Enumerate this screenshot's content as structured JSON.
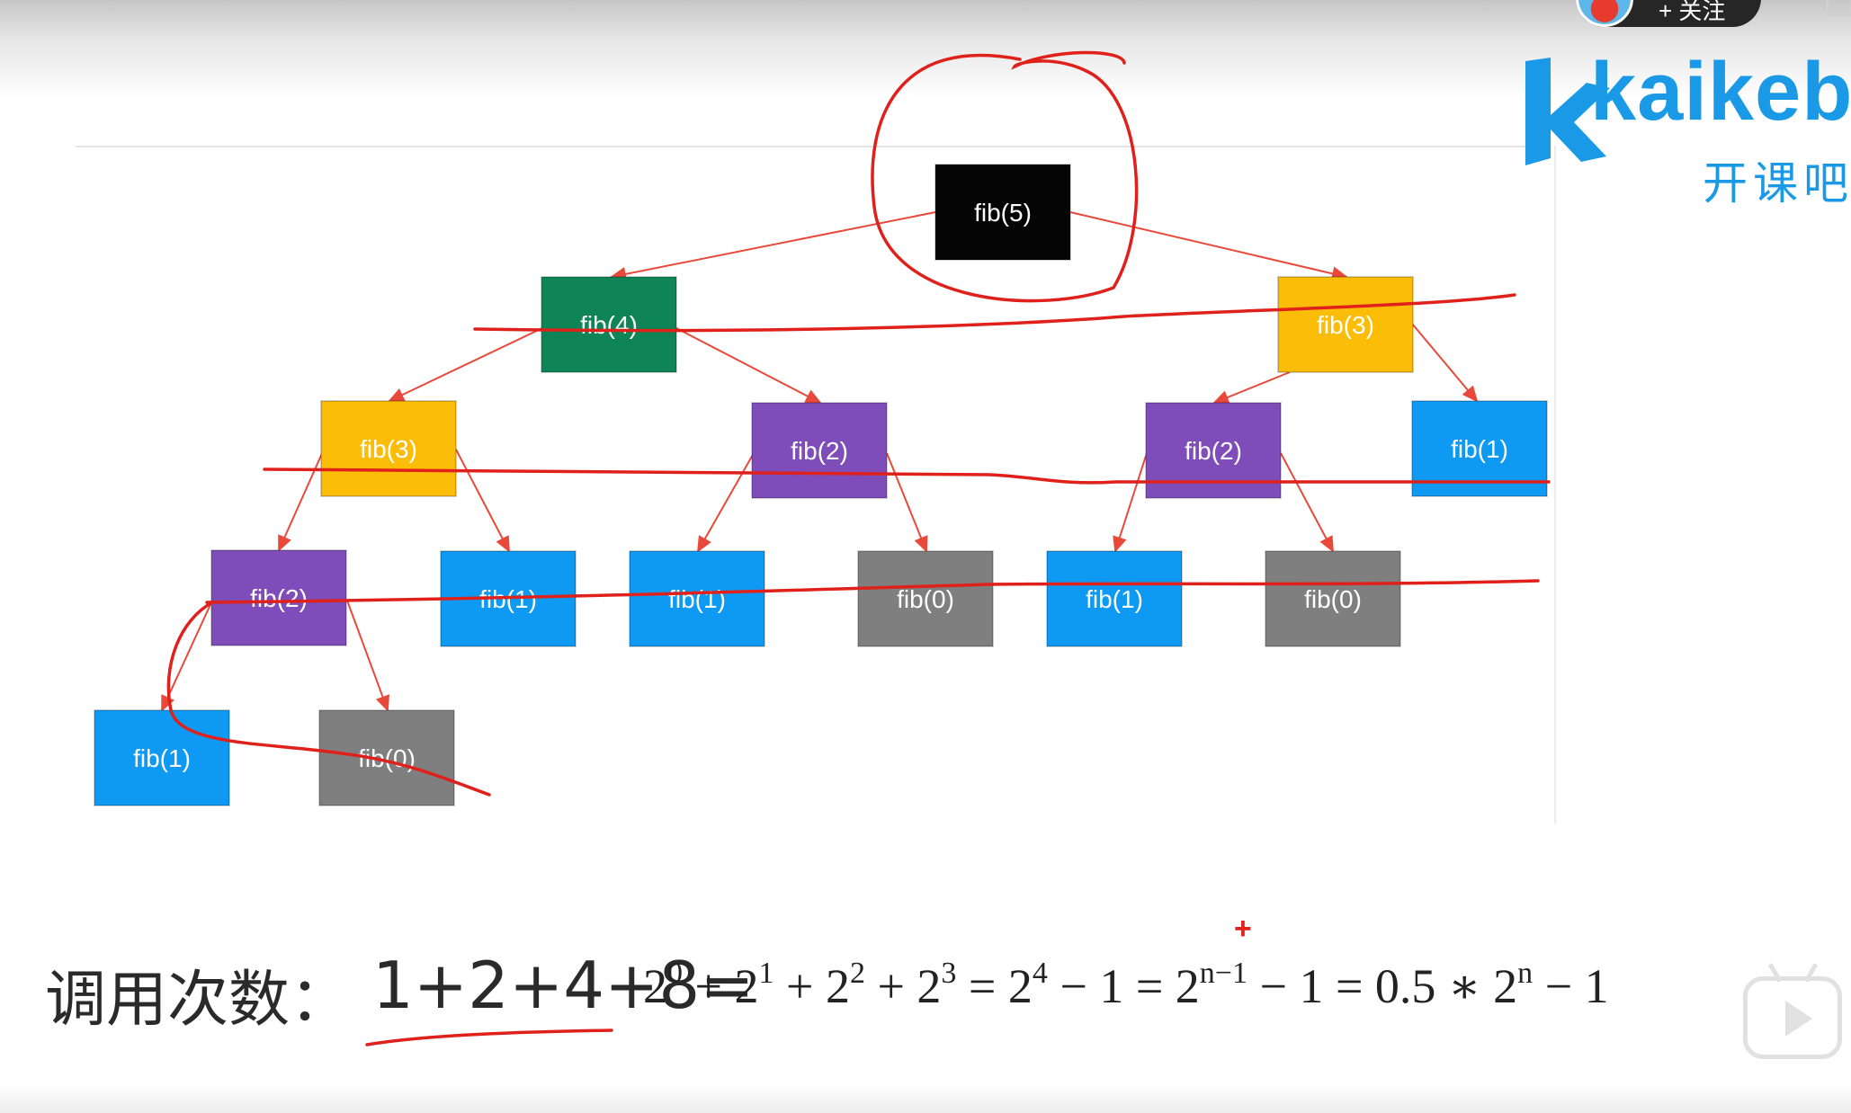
{
  "overlay": {
    "follow_label": "+ 关注",
    "logo_word": "kaikeba",
    "logo_cn": "开课吧"
  },
  "tree": {
    "nodes": [
      {
        "id": "n5",
        "label": "fib(5)",
        "color": "#050505"
      },
      {
        "id": "n4",
        "label": "fib(4)",
        "color": "#0f8557"
      },
      {
        "id": "n3r",
        "label": "fib(3)",
        "color": "#fbbd07"
      },
      {
        "id": "n3l",
        "label": "fib(3)",
        "color": "#fbbd07"
      },
      {
        "id": "n2a",
        "label": "fib(2)",
        "color": "#7e4db9"
      },
      {
        "id": "n2b",
        "label": "fib(2)",
        "color": "#7e4db9"
      },
      {
        "id": "n1a",
        "label": "fib(1)",
        "color": "#0e9af2"
      },
      {
        "id": "n2c",
        "label": "fib(2)",
        "color": "#7e4db9"
      },
      {
        "id": "n1b",
        "label": "fib(1)",
        "color": "#0e9af2"
      },
      {
        "id": "n1c",
        "label": "fib(1)",
        "color": "#0e9af2"
      },
      {
        "id": "n0a",
        "label": "fib(0)",
        "color": "#7f7f7f"
      },
      {
        "id": "n1d",
        "label": "fib(1)",
        "color": "#0e9af2"
      },
      {
        "id": "n0b",
        "label": "fib(0)",
        "color": "#7f7f7f"
      },
      {
        "id": "n1e",
        "label": "fib(1)",
        "color": "#0e9af2"
      },
      {
        "id": "n0c",
        "label": "fib(0)",
        "color": "#7f7f7f"
      }
    ],
    "edge_color": "#e8493a",
    "annotation_color": "#e0201b"
  },
  "formula": {
    "label": "调用次数：",
    "sum": "1+2+4+8=",
    "math_parts": [
      {
        "base": "2",
        "exp": "0"
      },
      {
        "op": " + "
      },
      {
        "base": "2",
        "exp": "1"
      },
      {
        "op": " + "
      },
      {
        "base": "2",
        "exp": "2"
      },
      {
        "op": " + "
      },
      {
        "base": "2",
        "exp": "3"
      },
      {
        "op": " = "
      },
      {
        "base": "2",
        "exp": "4"
      },
      {
        "op": " − 1 = "
      },
      {
        "base": "2",
        "exp": "n−1"
      },
      {
        "op": " − 1 = 0.5 ∗ "
      },
      {
        "base": "2",
        "exp": "n"
      },
      {
        "op": " − 1"
      }
    ],
    "plus_marker": "+"
  }
}
